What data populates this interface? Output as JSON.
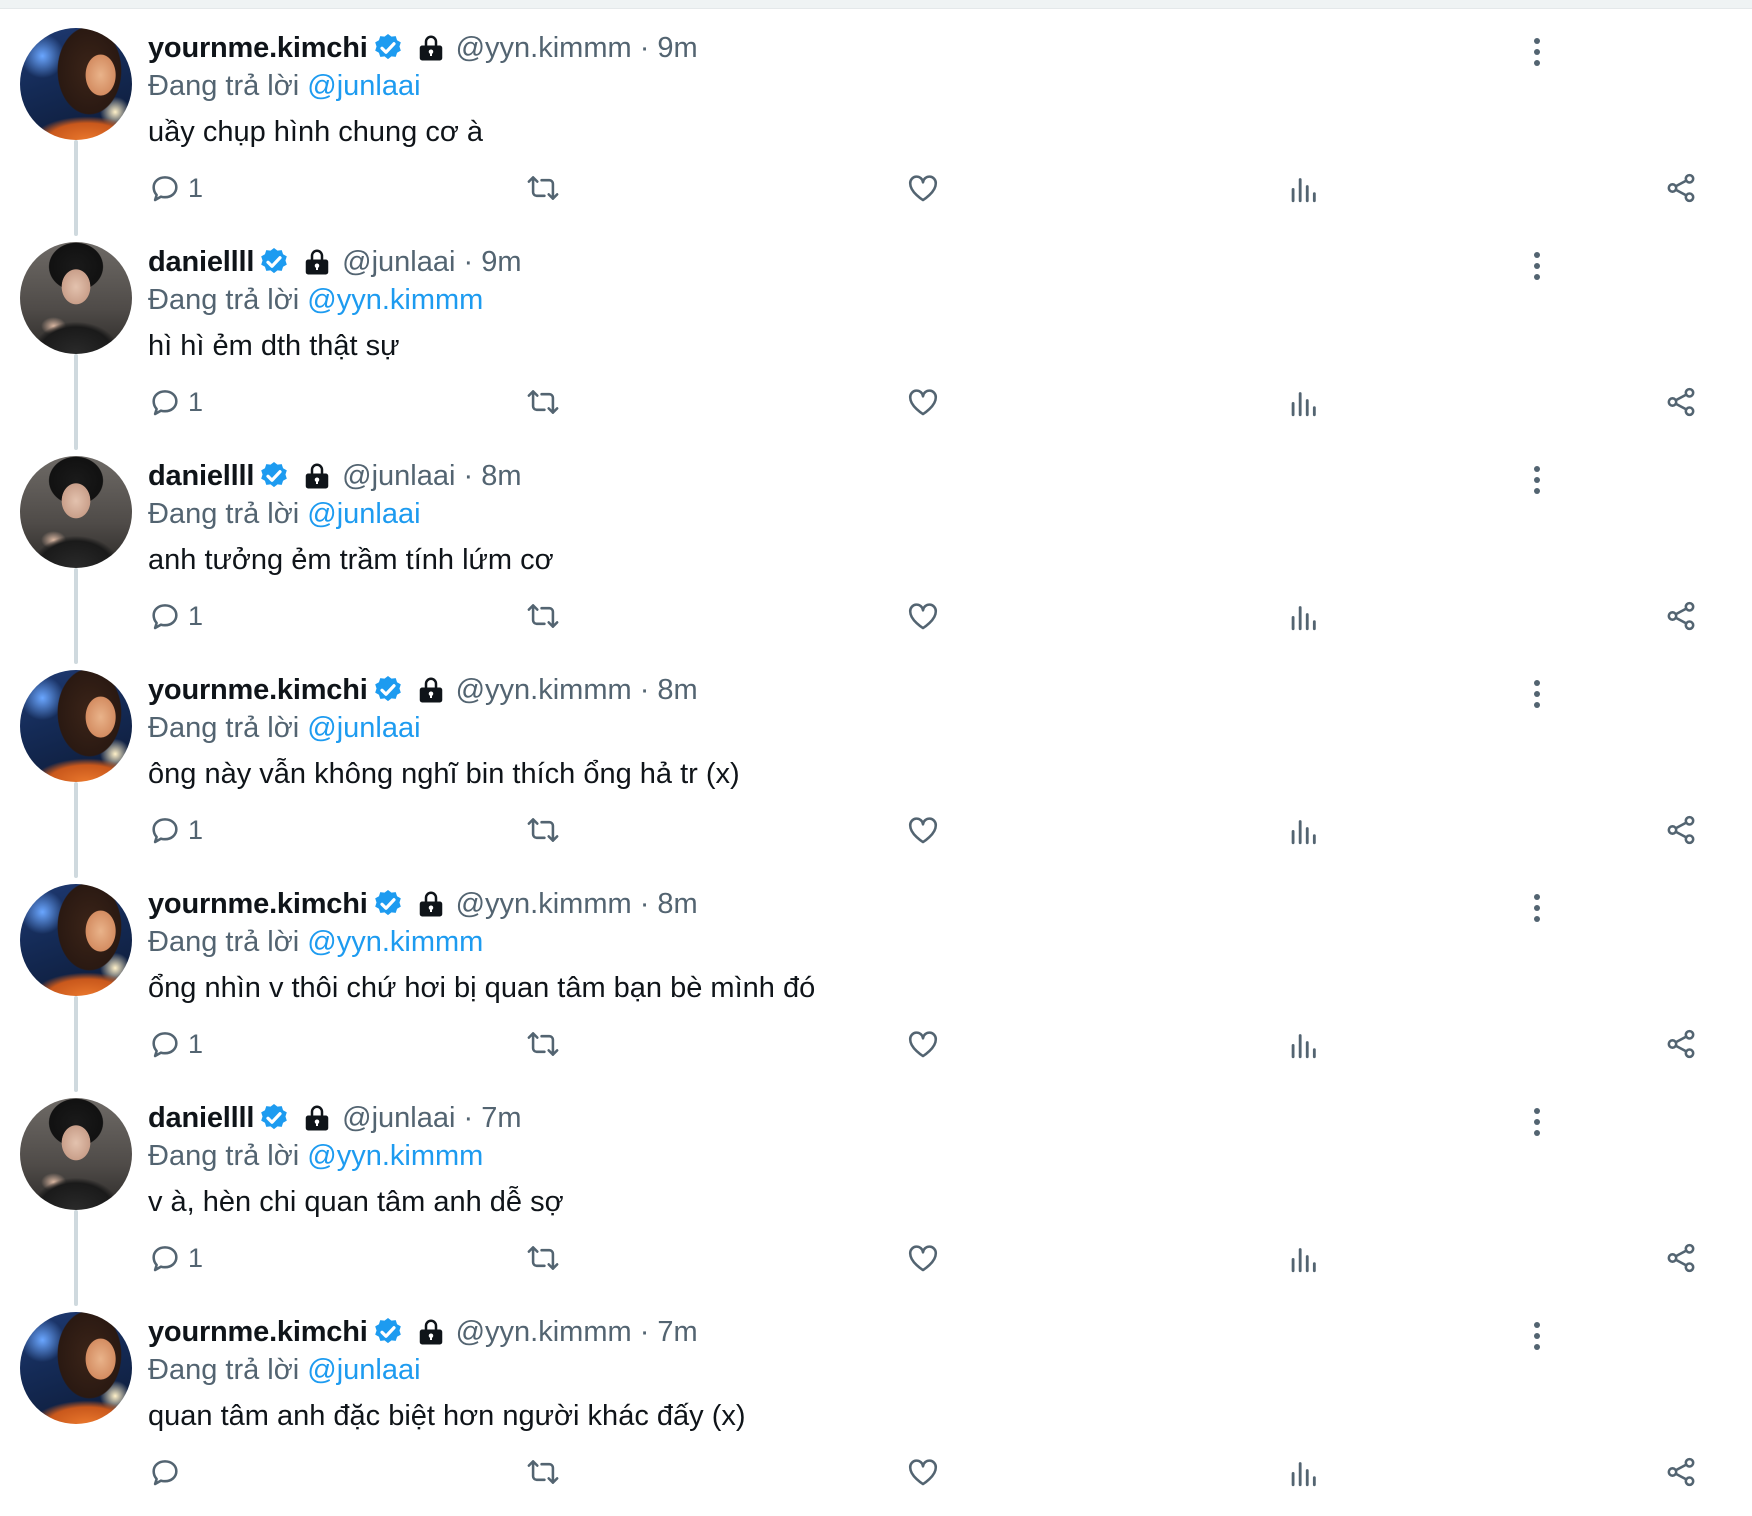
{
  "reply_prefix": "Đang trả lời",
  "colors": {
    "accent": "#1d9bf0",
    "muted": "#536471",
    "verified": "#1d9bf0"
  },
  "tweets": [
    {
      "avatar": "kimchi-avatar",
      "name": "yournme.kimchi",
      "handle_time": "@yyn.kimmm · 9m",
      "reply_to": "@junlaai",
      "text": "uầy chụp hình chung cơ à",
      "reply_count": "1"
    },
    {
      "avatar": "daniel-avatar",
      "name": "daniellll",
      "handle_time": "@junlaai · 9m",
      "reply_to": "@yyn.kimmm",
      "text": "hì hì ẻm dth thật sự",
      "reply_count": "1"
    },
    {
      "avatar": "daniel-avatar",
      "name": "daniellll",
      "handle_time": "@junlaai · 8m",
      "reply_to": "@junlaai",
      "text": "anh tưởng ẻm trầm tính lứm cơ",
      "reply_count": "1"
    },
    {
      "avatar": "kimchi-avatar",
      "name": "yournme.kimchi",
      "handle_time": "@yyn.kimmm · 8m",
      "reply_to": "@junlaai",
      "text": "ông này vẫn không nghĩ bin thích ổng hả tr (x)",
      "reply_count": "1"
    },
    {
      "avatar": "kimchi-avatar",
      "name": "yournme.kimchi",
      "handle_time": "@yyn.kimmm · 8m",
      "reply_to": "@yyn.kimmm",
      "text": "ổng nhìn v thôi chứ hơi bị quan tâm bạn bè mình đó",
      "reply_count": "1"
    },
    {
      "avatar": "daniel-avatar",
      "name": "daniellll",
      "handle_time": "@junlaai · 7m",
      "reply_to": "@yyn.kimmm",
      "text": "v à, hèn chi quan tâm anh dễ sợ",
      "reply_count": "1"
    },
    {
      "avatar": "kimchi-avatar",
      "name": "yournme.kimchi",
      "handle_time": "@yyn.kimmm · 7m",
      "reply_to": "@junlaai",
      "text": "quan tâm anh đặc biệt hơn người khác đấy (x)",
      "reply_count": ""
    }
  ]
}
